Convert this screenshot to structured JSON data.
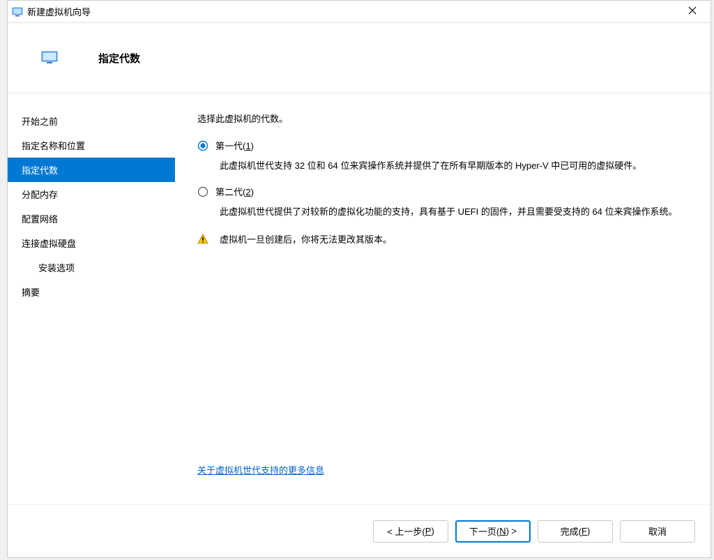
{
  "window": {
    "title": "新建虚拟机向导"
  },
  "header": {
    "title": "指定代数"
  },
  "sidebar": {
    "items": [
      {
        "label": "开始之前",
        "active": false
      },
      {
        "label": "指定名称和位置",
        "active": false
      },
      {
        "label": "指定代数",
        "active": true
      },
      {
        "label": "分配内存",
        "active": false
      },
      {
        "label": "配置网络",
        "active": false
      },
      {
        "label": "连接虚拟硬盘",
        "active": false
      },
      {
        "label": "安装选项",
        "active": false,
        "indent": true
      },
      {
        "label": "摘要",
        "active": false
      }
    ]
  },
  "content": {
    "intro": "选择此虚拟机的代数。",
    "option1": {
      "label_pre": "第一代(",
      "label_accel": "1",
      "label_post": ")",
      "selected": true,
      "desc": "此虚拟机世代支持 32 位和 64 位来宾操作系统并提供了在所有早期版本的 Hyper-V 中已可用的虚拟硬件。"
    },
    "option2": {
      "label_pre": "第二代(",
      "label_accel": "2",
      "label_post": ")",
      "selected": false,
      "desc": "此虚拟机世代提供了对较新的虚拟化功能的支持，具有基于 UEFI 的固件，并且需要受支持的 64 位来宾操作系统。"
    },
    "warning": "虚拟机一旦创建后，你将无法更改其版本。",
    "link": "关于虚拟机世代支持的更多信息"
  },
  "footer": {
    "back_pre": "< 上一步(",
    "back_accel": "P",
    "back_post": ")",
    "next_pre": "下一页(",
    "next_accel": "N",
    "next_post": ") >",
    "finish_pre": "完成(",
    "finish_accel": "F",
    "finish_post": ")",
    "cancel": "取消"
  }
}
